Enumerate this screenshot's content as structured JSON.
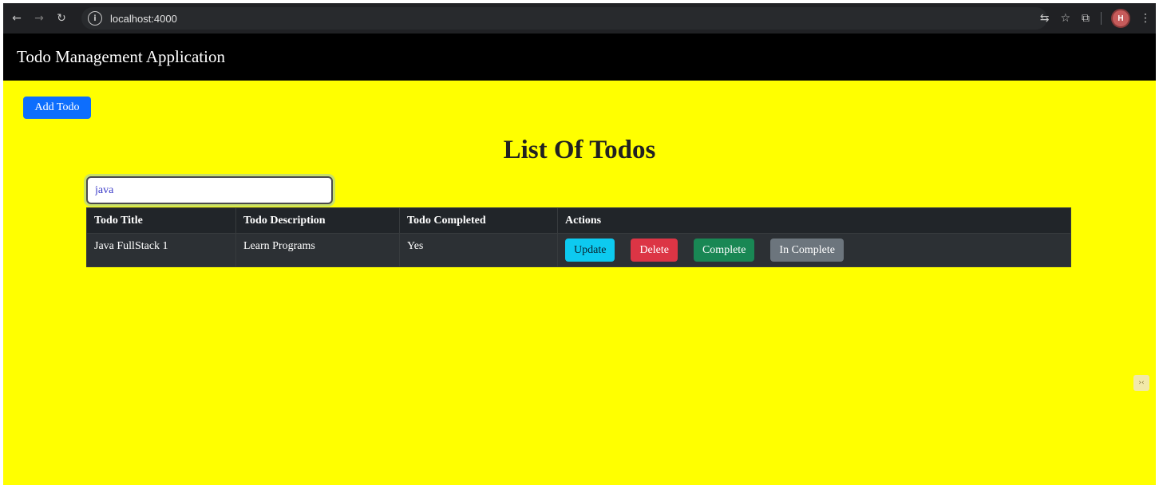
{
  "browser": {
    "url": "localhost:4000",
    "profile_initial": "H",
    "icons": [
      "back-icon",
      "forward-icon",
      "reload-icon",
      "site-info-icon",
      "translate-icon",
      "bookmark-star-icon",
      "extensions-icon",
      "menu-icon"
    ]
  },
  "header": {
    "title": "Todo Management Application"
  },
  "toolbar": {
    "add_label": "Add Todo"
  },
  "list": {
    "title": "List Of Todos",
    "search_value": "java",
    "columns": [
      "Todo Title",
      "Todo Description",
      "Todo Completed",
      "Actions"
    ],
    "rows": [
      {
        "title": "Java FullStack 1",
        "description": "Learn Programs",
        "completed": "Yes",
        "actions": [
          "Update",
          "Delete",
          "Complete",
          "In Complete"
        ]
      }
    ]
  },
  "colors": {
    "page_bg": "#ffff00",
    "header_bg": "#000000",
    "primary": "#0d6efd",
    "info": "#0dcaf0",
    "danger": "#dc3545",
    "success": "#198754",
    "secondary": "#6c757d",
    "table_dark": "#212529"
  }
}
